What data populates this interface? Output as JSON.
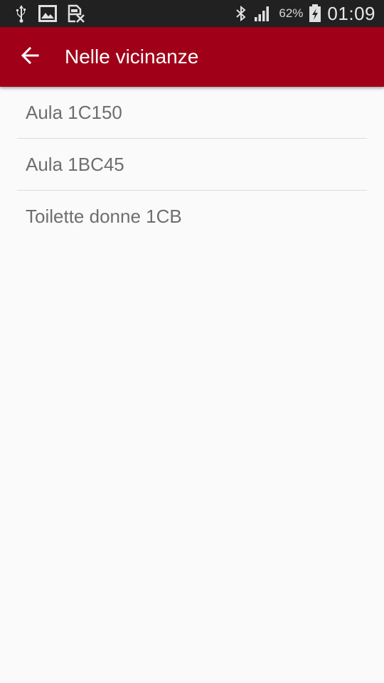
{
  "status_bar": {
    "icons_left": [
      "usb-icon",
      "image-icon",
      "no-sim-icon"
    ],
    "icons_right": [
      "bluetooth-icon",
      "signal-icon",
      "battery-charging-icon"
    ],
    "battery_percent": "62%",
    "time": "01:09"
  },
  "app_bar": {
    "title": "Nelle vicinanze",
    "background": "#a00018",
    "back_icon": "arrow-back-icon"
  },
  "list": {
    "items": [
      {
        "label": "Aula 1C150"
      },
      {
        "label": "Aula 1BC45"
      },
      {
        "label": "Toilette donne 1CB"
      }
    ]
  }
}
